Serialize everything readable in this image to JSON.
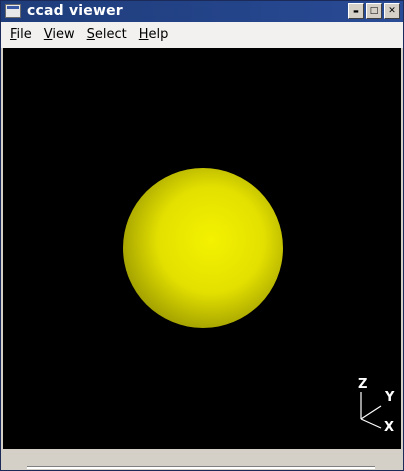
{
  "window": {
    "title": "ccad viewer",
    "buttons": {
      "minimize_glyph": "▬",
      "maximize_glyph": "□",
      "close_glyph": "✕"
    }
  },
  "menu": {
    "items": [
      {
        "label_accel": "F",
        "label_rest": "ile"
      },
      {
        "label_accel": "V",
        "label_rest": "iew"
      },
      {
        "label_accel": "S",
        "label_rest": "elect"
      },
      {
        "label_accel": "H",
        "label_rest": "elp"
      }
    ]
  },
  "viewer": {
    "background": "#000000",
    "object": {
      "shape": "sphere",
      "color": "#e9e600",
      "highlight": "#f4f200",
      "shadow": "#9c9a00"
    },
    "axes": {
      "z": "Z",
      "y": "Y",
      "x": "X",
      "color": "#ffffff"
    }
  }
}
